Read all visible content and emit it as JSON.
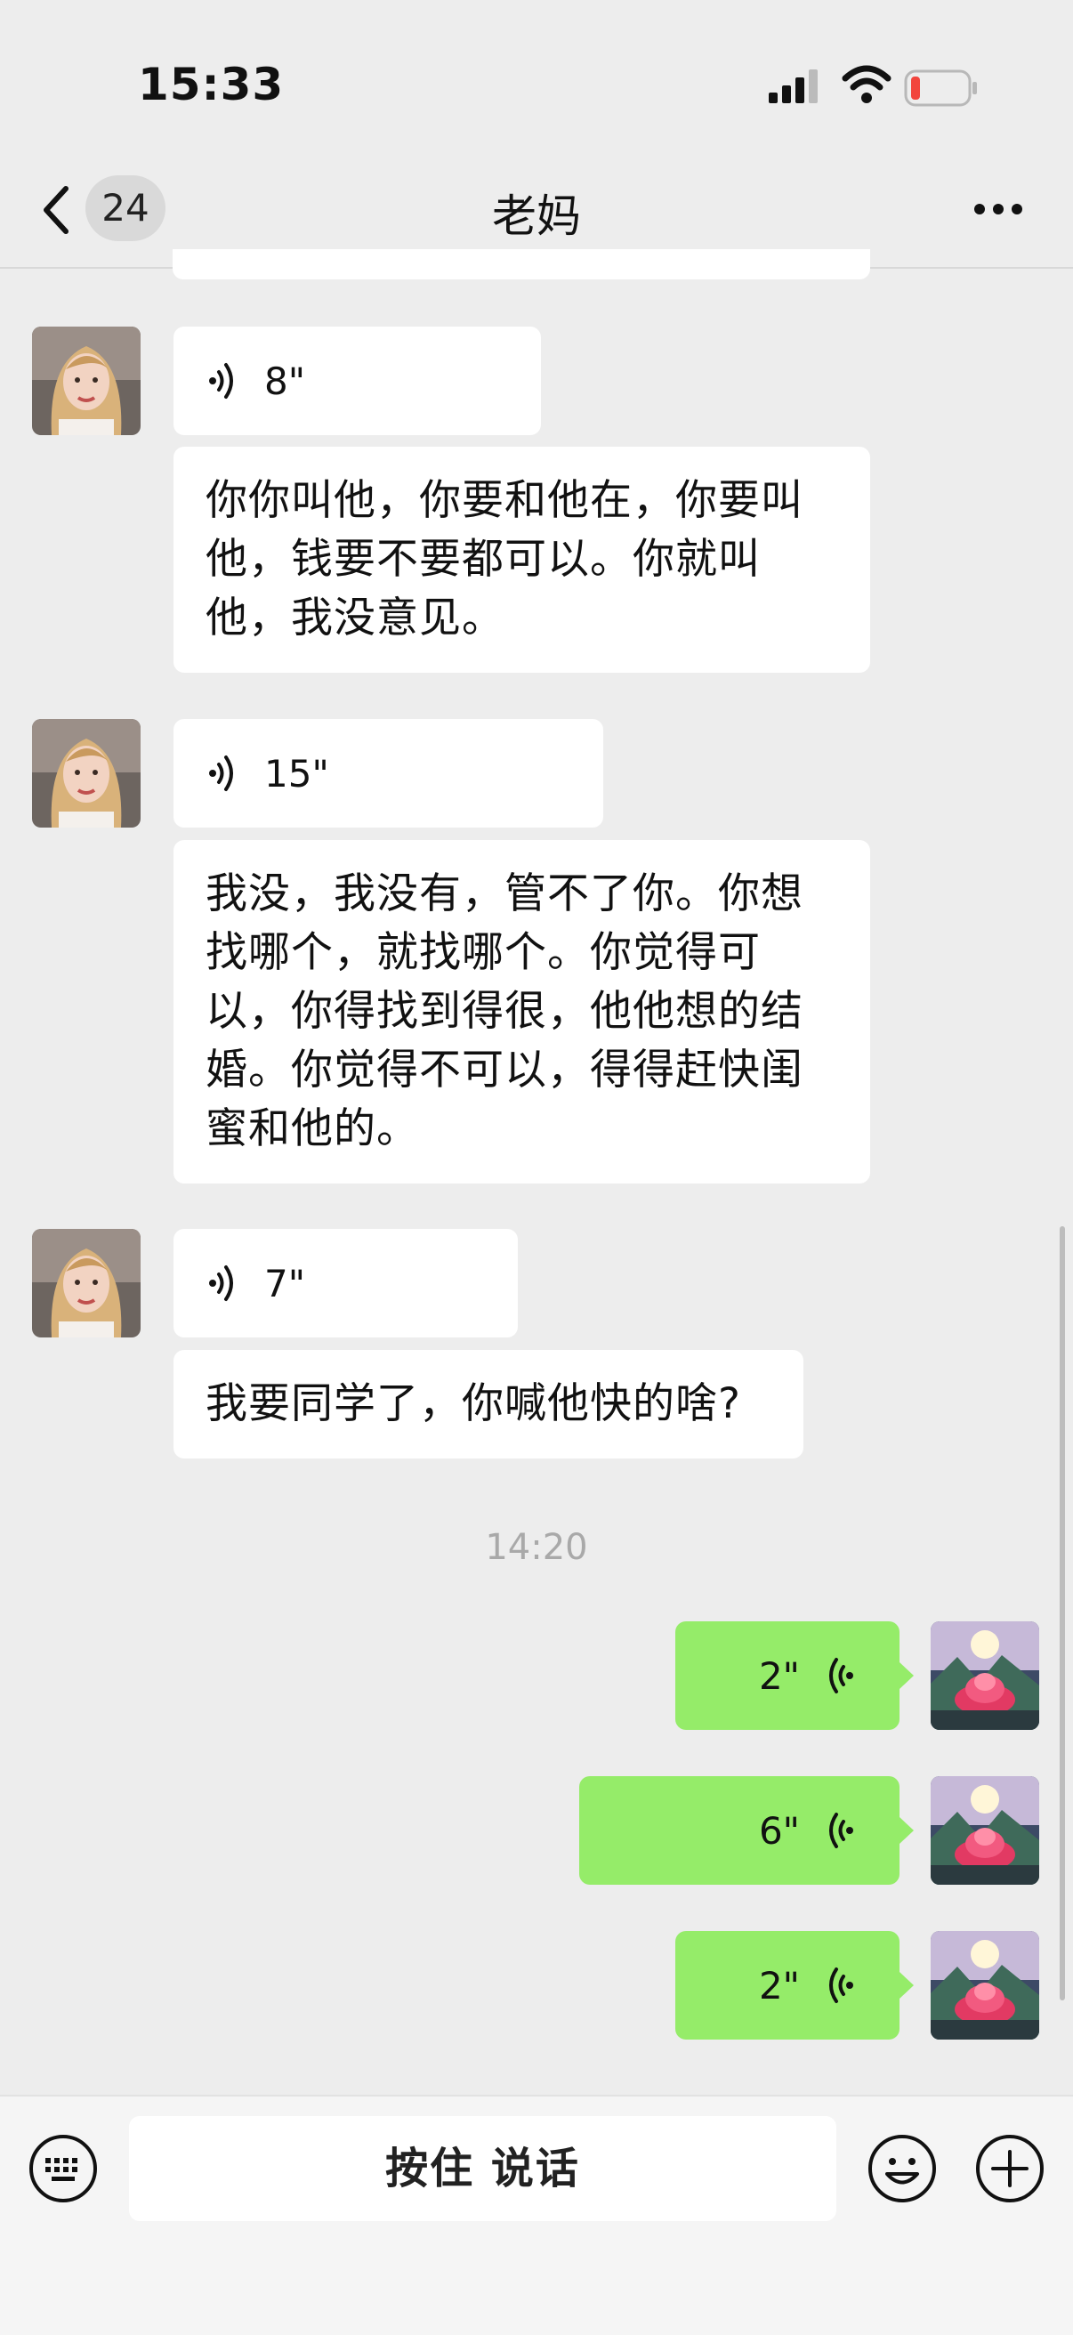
{
  "status_bar": {
    "time": "15:33"
  },
  "header": {
    "unread_count": "24",
    "title": "老妈"
  },
  "messages": [
    {
      "type": "voice",
      "direction": "incoming",
      "duration": "8\""
    },
    {
      "type": "text",
      "direction": "incoming",
      "lines": [
        "你你叫他，你要和他在，你要叫",
        "他，钱要不要都可以。你就叫",
        "他，我没意见。"
      ]
    },
    {
      "type": "voice",
      "direction": "incoming",
      "duration": "15\""
    },
    {
      "type": "text",
      "direction": "incoming",
      "lines": [
        "我没，我没有，管不了你。你想",
        "找哪个，就找哪个。你觉得可",
        "以，你得找到得很，他他想的结",
        "婚。你觉得不可以，得得赶快闺",
        "蜜和他的。"
      ]
    },
    {
      "type": "voice",
      "direction": "incoming",
      "duration": "7\""
    },
    {
      "type": "text",
      "direction": "incoming",
      "lines": [
        "我要同学了，你喊他快的啥?"
      ]
    },
    {
      "type": "timestamp",
      "text": "14:20"
    },
    {
      "type": "voice",
      "direction": "outgoing",
      "duration": "2\""
    },
    {
      "type": "voice",
      "direction": "outgoing",
      "duration": "6\""
    },
    {
      "type": "voice",
      "direction": "outgoing",
      "duration": "2\""
    }
  ],
  "input_bar": {
    "press_to_talk_label": "按住 说话"
  },
  "colors": {
    "outgoing_bubble": "#95ec69",
    "incoming_bubble": "#ffffff",
    "background": "#ededed",
    "battery_low": "#f2453d"
  },
  "icons": [
    "back-chevron-icon",
    "more-icon",
    "voice-wave-icon",
    "keyboard-icon",
    "emoji-icon",
    "plus-icon"
  ]
}
